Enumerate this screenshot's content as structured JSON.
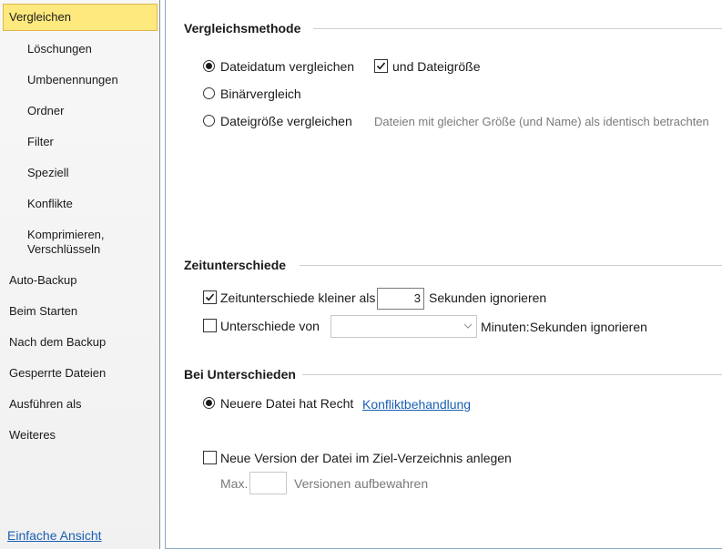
{
  "sidebar": {
    "items": [
      {
        "label": "Vergleichen",
        "sub": false,
        "selected": true
      },
      {
        "label": "Löschungen",
        "sub": true
      },
      {
        "label": "Umbenennungen",
        "sub": true
      },
      {
        "label": "Ordner",
        "sub": true
      },
      {
        "label": "Filter",
        "sub": true
      },
      {
        "label": "Speziell",
        "sub": true
      },
      {
        "label": "Konflikte",
        "sub": true
      },
      {
        "label": "Komprimieren,",
        "label2": "Verschlüsseln",
        "sub": true
      },
      {
        "label": "Auto-Backup",
        "sub": false
      },
      {
        "label": "Beim Starten",
        "sub": false
      },
      {
        "label": "Nach dem Backup",
        "sub": false
      },
      {
        "label": "Gesperrte Dateien",
        "sub": false
      },
      {
        "label": "Ausführen als",
        "sub": false
      },
      {
        "label": "Weiteres",
        "sub": false
      }
    ],
    "footer_link": "Einfache Ansicht"
  },
  "compare": {
    "title": "Vergleichsmethode",
    "opt_date": "Dateidatum vergleichen",
    "opt_size_too": "und Dateigröße",
    "opt_binary": "Binärvergleich",
    "opt_size": "Dateigröße vergleichen",
    "size_hint": "Dateien mit gleicher Größe (und Name) als identisch betrachten"
  },
  "time": {
    "title": "Zeitunterschiede",
    "ignore_label": "Zeitunterschiede kleiner als",
    "seconds_value": "3",
    "seconds_suffix": "Sekunden ignorieren",
    "diff_label": "Unterschiede von",
    "diff_suffix": "Minuten:Sekunden ignorieren"
  },
  "differences": {
    "title": "Bei Unterschieden",
    "newer_wins": "Neuere Datei hat Recht",
    "conflict_link": "Konfliktbehandlung",
    "new_version": "Neue Version der Datei im Ziel-Verzeichnis anlegen",
    "max_label": "Max.",
    "keep_label": "Versionen aufbewahren"
  }
}
